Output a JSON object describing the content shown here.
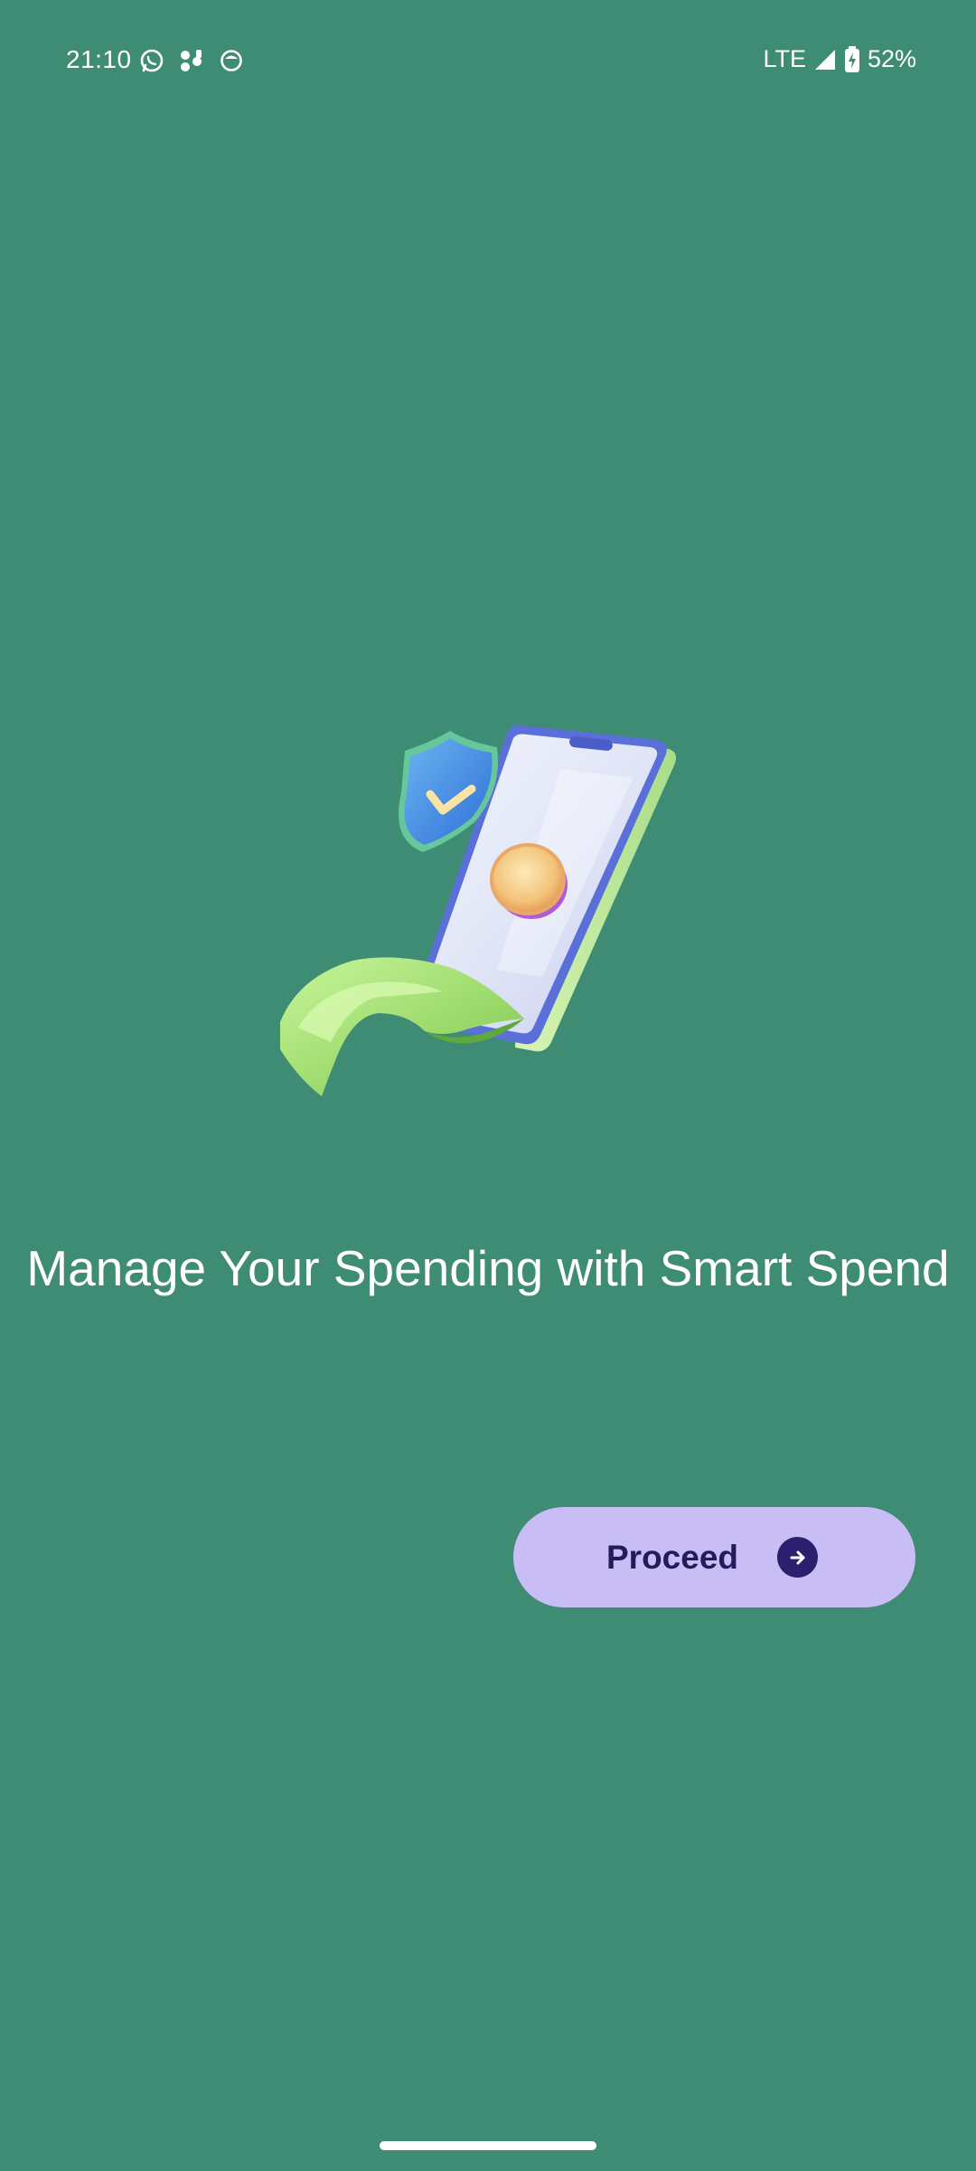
{
  "status_bar": {
    "time": "21:10",
    "left_icons": [
      "whatsapp-icon",
      "music-notes-icon",
      "app-face-icon"
    ],
    "network": "LTE",
    "battery": "52%",
    "battery_level_percent": 52
  },
  "onboarding": {
    "illustration": "phone-shield-coin-illustration",
    "headline": "Manage Your Spending with Smart Spend",
    "proceed_label": "Proceed",
    "proceed_icon": "arrow-right-circle-icon"
  },
  "colors": {
    "background": "#3f8c75",
    "button_bg": "#c9bdf5",
    "button_text": "#241a5c",
    "text": "#ffffff"
  }
}
